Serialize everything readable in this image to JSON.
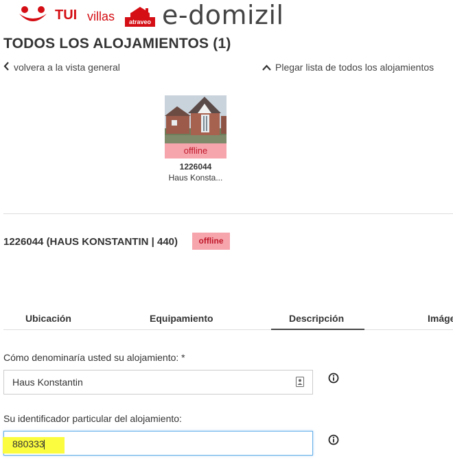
{
  "logos": {
    "tui": "TUI",
    "villas": "villas",
    "atraveo": "atraveo",
    "edomizil": "e-domizil",
    "brand_red": "#d40e14"
  },
  "page": {
    "title": "TODOS LOS ALOJAMIENTOS (1)",
    "back_link": "volvera a la vista general",
    "collapse_link": "Plegar lista de todos los alojamientos"
  },
  "card": {
    "status": "offline",
    "id": "1226044",
    "name": "Haus Konsta..."
  },
  "detail": {
    "heading": "1226044 (HAUS KONSTANTIN | 440)",
    "status_badge": "offline",
    "offline_bg": "#f6a5ad",
    "offline_text_color": "#c0182a"
  },
  "tabs": [
    {
      "label": "Ubicación",
      "active": false
    },
    {
      "label": "Equipamiento",
      "active": false
    },
    {
      "label": "Descripción",
      "active": true
    },
    {
      "label": "Imágenes",
      "active": false
    }
  ],
  "form": {
    "name_field": {
      "label": "Cómo denominaría usted su alojamiento: *",
      "value": "Haus Konstantin",
      "icon": "contact-card-icon"
    },
    "identifier_field": {
      "label": "Su identificador particular del alojamiento:",
      "value": "880333",
      "highlight_color": "#fbfb3f"
    },
    "info_icon": "info-icon"
  }
}
